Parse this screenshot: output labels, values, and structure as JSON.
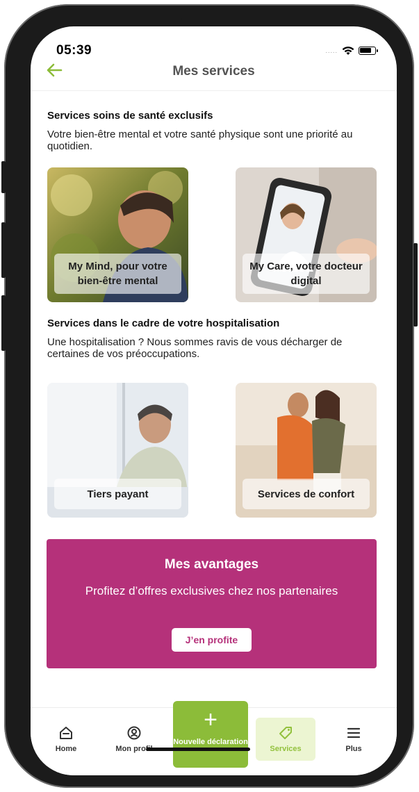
{
  "status_bar": {
    "time": "05:39",
    "signal": "....."
  },
  "header": {
    "title": "Mes services",
    "back_icon": "arrow-left-icon"
  },
  "section_health": {
    "title": "Services soins de santé exclusifs",
    "text": "Votre bien-être mental et votre santé physique sont une priorité au quotidien.",
    "cards": [
      {
        "label": "My Mind, pour votre bien-être mental"
      },
      {
        "label": "My Care, votre docteur digital"
      }
    ]
  },
  "section_hospital": {
    "title": "Services dans le cadre de votre hospitalisation",
    "text": "Une hospitalisation ? Nous sommes ravis de vous décharger de certaines de vos préoccupations.",
    "cards": [
      {
        "label": "Tiers payant"
      },
      {
        "label": "Services de confort"
      }
    ]
  },
  "promo": {
    "title": "Mes avantages",
    "text": "Profitez d’offres exclusives chez nos partenaires",
    "button": "J’en profite"
  },
  "nav": {
    "items": [
      {
        "label": "Home",
        "icon": "home-icon"
      },
      {
        "label": "Mon profil",
        "icon": "profile-icon"
      },
      {
        "label": "Nouvelle déclaration",
        "icon": "plus-icon"
      },
      {
        "label": "Services",
        "icon": "tag-icon",
        "active": true
      },
      {
        "label": "Plus",
        "icon": "menu-icon"
      }
    ]
  },
  "colors": {
    "accent_green": "#8cbc39",
    "promo_magenta": "#b5317a",
    "nav_active_bg": "#ecf5d2"
  }
}
